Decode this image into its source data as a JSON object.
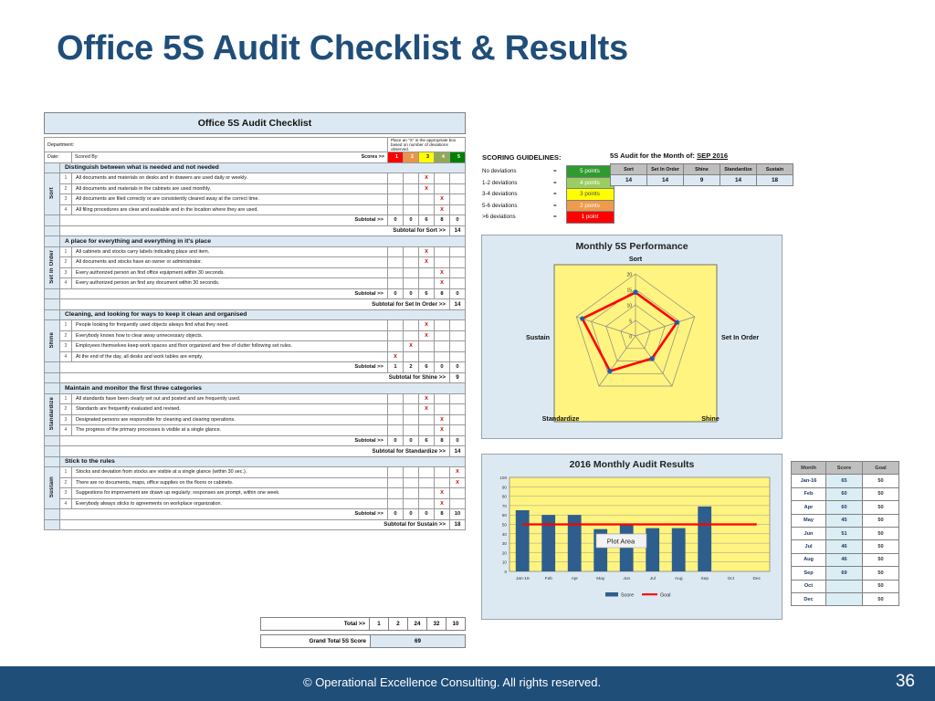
{
  "slide": {
    "title": "Office 5S Audit Checklist & Results",
    "footer_text": "© Operational Excellence Consulting.  All rights reserved.",
    "page_number": "36"
  },
  "checklist": {
    "title": "Office 5S Audit Checklist",
    "department_label": "Department:",
    "date_label": "Date:",
    "scored_by_label": "Scored By:",
    "instruction": "Place an \"X\" in the appropriate box based on number of deviations observed.",
    "scores_label": "Scores >>",
    "score_headers": [
      "1",
      "2",
      "3",
      "4",
      "5"
    ],
    "subtotal_label": "Subtotal >>",
    "sections": [
      {
        "side": "Sort",
        "heading": "Distinguish between what is needed and not needed",
        "rows": [
          {
            "num": "1",
            "text": "All documents and materials on desks and in drawers are used daily or weekly.",
            "mark": 3
          },
          {
            "num": "2",
            "text": "All documents and materials in the cabinets are used monthly.",
            "mark": 3
          },
          {
            "num": "3",
            "text": "All documents are filed correctly or are consistently cleared away at the correct time.",
            "mark": 4
          },
          {
            "num": "4",
            "text": "All filing procedures are clear and available and in the location where they are used.",
            "mark": 4
          }
        ],
        "subtotals": [
          "0",
          "0",
          "6",
          "8",
          "0"
        ],
        "section_total_label": "Subtotal for Sort >>",
        "section_total": "14"
      },
      {
        "side": "Set In Order",
        "heading": "A place for everything and everything in it's place",
        "rows": [
          {
            "num": "1",
            "text": "All cabinets and stocks carry labels indicating place and item.",
            "mark": 3
          },
          {
            "num": "2",
            "text": "All documents and stocks have an owner or administrator.",
            "mark": 3
          },
          {
            "num": "3",
            "text": "Every authorized person an find office equipment within 30 seconds.",
            "mark": 4
          },
          {
            "num": "4",
            "text": "Every authorized person an find any document within 30 seconds.",
            "mark": 4
          }
        ],
        "subtotals": [
          "0",
          "0",
          "6",
          "8",
          "0"
        ],
        "section_total_label": "Subtotal for Set In Order >>",
        "section_total": "14"
      },
      {
        "side": "Shine",
        "heading": "Cleaning, and looking for ways to keep it clean and organised",
        "rows": [
          {
            "num": "1",
            "text": "People looking for frequently used objects always find what they need.",
            "mark": 3
          },
          {
            "num": "2",
            "text": "Everybody knows how to clear away unnecessary objects.",
            "mark": 3
          },
          {
            "num": "3",
            "text": "Employees themselves keep work spaces and floor organized and free of clutter following set rules.",
            "mark": 2
          },
          {
            "num": "4",
            "text": "At the end of the day, all desks and work tables are empty.",
            "mark": 1
          }
        ],
        "subtotals": [
          "1",
          "2",
          "6",
          "0",
          "0"
        ],
        "section_total_label": "Subtotal for Shine >>",
        "section_total": "9"
      },
      {
        "side": "Standardize",
        "heading": "Maintain and monitor the first three categories",
        "rows": [
          {
            "num": "1",
            "text": "All standards have been clearly set out and posted and are frequently used.",
            "mark": 3
          },
          {
            "num": "2",
            "text": "Standards are frequently evaluated and revised.",
            "mark": 3
          },
          {
            "num": "3",
            "text": "Designated persons are responsible for cleaning and clearing operations.",
            "mark": 4
          },
          {
            "num": "4",
            "text": "The progress of the primary processes is visible at a single glance.",
            "mark": 4
          }
        ],
        "subtotals": [
          "0",
          "0",
          "6",
          "8",
          "0"
        ],
        "section_total_label": "Subtotal for Standardize >>",
        "section_total": "14"
      },
      {
        "side": "Sustain",
        "heading": "Stick to the rules",
        "rows": [
          {
            "num": "1",
            "text": "Stocks and deviation from stocks are visible at a single glance (within 30 sec.).",
            "mark": 5
          },
          {
            "num": "2",
            "text": "There are no documents, maps, office supplies on the floors or cabinets.",
            "mark": 5
          },
          {
            "num": "3",
            "text": "Suggestions for improvement are drawn up regularly; responses are prompt, within one week.",
            "mark": 4
          },
          {
            "num": "4",
            "text": "Everybody always sticks to agreements on workplace organization.",
            "mark": 4
          }
        ],
        "subtotals": [
          "0",
          "0",
          "0",
          "8",
          "10"
        ],
        "section_total_label": "Subtotal for Sustain >>",
        "section_total": "18"
      }
    ],
    "totals": {
      "total_label": "Total >>",
      "total_values": [
        "1",
        "2",
        "24",
        "32",
        "10"
      ],
      "grand_total_label": "Grand Total 5S Score",
      "grand_total": "69"
    }
  },
  "scoring_guidelines": {
    "title": "SCORING GUIDELINES:",
    "rows": [
      {
        "deviations": "No deviations",
        "eq": "=",
        "points": "5 points",
        "color": "#2E9B2E"
      },
      {
        "deviations": "1-2 deviations",
        "eq": "=",
        "points": "4 points",
        "color": "#9ACD62"
      },
      {
        "deviations": "3-4 deviations",
        "eq": "=",
        "points": "3 points",
        "color": "#FFFF00"
      },
      {
        "deviations": "5-6 deviations",
        "eq": "=",
        "points": "2 points",
        "color": "#F09A4C"
      },
      {
        "deviations": ">6 deviations",
        "eq": "=",
        "points": "1 point",
        "color": "#FF0000"
      }
    ]
  },
  "month_audit": {
    "title_prefix": "5S Audit for the Month of:",
    "month": "SEP 2016",
    "headers": [
      "Sort",
      "Set In Order",
      "Shine",
      "Standardize",
      "Sustain"
    ],
    "values": [
      "14",
      "14",
      "9",
      "14",
      "18"
    ]
  },
  "radar_chart": {
    "title": "Monthly 5S Performance"
  },
  "bar_chart": {
    "title": "2016 Monthly Audit Results",
    "plot_area_label": "Plot Area",
    "legend": [
      "Score",
      "Goal"
    ]
  },
  "month_table": {
    "headers": [
      "Month",
      "Score",
      "Goal"
    ],
    "rows": [
      {
        "month": "Jan-16",
        "score": "65",
        "goal": "50"
      },
      {
        "month": "Feb",
        "score": "60",
        "goal": "50"
      },
      {
        "month": "Apr",
        "score": "60",
        "goal": "50"
      },
      {
        "month": "May",
        "score": "45",
        "goal": "50"
      },
      {
        "month": "Jun",
        "score": "51",
        "goal": "50"
      },
      {
        "month": "Jul",
        "score": "46",
        "goal": "50"
      },
      {
        "month": "Aug",
        "score": "46",
        "goal": "50"
      },
      {
        "month": "Sep",
        "score": "69",
        "goal": "50"
      },
      {
        "month": "Oct",
        "score": "",
        "goal": "50"
      },
      {
        "month": "Dec",
        "score": "",
        "goal": "50"
      }
    ]
  },
  "chart_data": [
    {
      "type": "radar",
      "title": "Monthly 5S Performance",
      "categories": [
        "Sort",
        "Set In Order",
        "Shine",
        "Standardize",
        "Sustain"
      ],
      "values": [
        14,
        14,
        9,
        14,
        18
      ],
      "ticks": [
        "0",
        "5",
        "10",
        "15",
        "20"
      ],
      "rlim": [
        0,
        20
      ],
      "series_color": "#FF0000",
      "marker_color": "#1F5CA8",
      "plot_bg": "#FFF47F",
      "legend": "none"
    },
    {
      "type": "bar",
      "title": "2016 Monthly Audit Results",
      "categories": [
        "Jan-16",
        "Feb",
        "Apr",
        "May",
        "Jun",
        "Jul",
        "Aug",
        "Sep",
        "Oct",
        "Dec"
      ],
      "series": [
        {
          "name": "Score",
          "type": "bar",
          "values": [
            65,
            60,
            60,
            45,
            51,
            46,
            46,
            69,
            null,
            null
          ],
          "color": "#2E5E8E"
        },
        {
          "name": "Goal",
          "type": "line",
          "values": [
            50,
            50,
            50,
            50,
            50,
            50,
            50,
            50,
            50,
            50
          ],
          "color": "#FF0000"
        }
      ],
      "xlabel": "",
      "ylabel": "",
      "ylim": [
        0,
        100
      ],
      "yticks": [
        0,
        10,
        20,
        30,
        40,
        50,
        60,
        70,
        80,
        90,
        100
      ],
      "grid": true,
      "plot_bg": "#FFF47F",
      "legend_position": "bottom"
    }
  ]
}
